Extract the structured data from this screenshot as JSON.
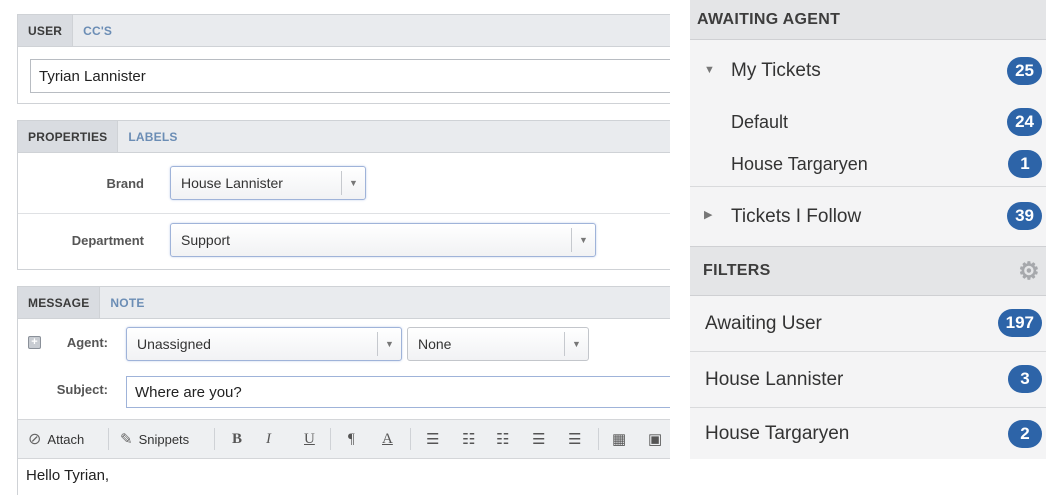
{
  "form": {
    "user_tabs": [
      "USER",
      "CC'S"
    ],
    "user_value": "Tyrian Lannister",
    "property_tabs": [
      "PROPERTIES",
      "LABELS"
    ],
    "brand_label": "Brand",
    "brand_value": "House Lannister",
    "department_label": "Department",
    "department_value": "Support",
    "message_tabs": [
      "MESSAGE",
      "NOTE"
    ],
    "agent_label": "Agent:",
    "agent_value": "Unassigned",
    "team_value": "None",
    "subject_label": "Subject:",
    "subject_value": "Where are you?",
    "toolbar": {
      "attach_label": "Attach",
      "snippets_label": "Snippets",
      "bold": "B",
      "italic": "I",
      "underline": "U",
      "paragraph": "¶",
      "font_color": "A"
    },
    "body_text": "Hello Tyrian,"
  },
  "sidebar": {
    "awaiting_agent_title": "AWAITING AGENT",
    "my_tickets": {
      "label": "My Tickets",
      "count": "25"
    },
    "sub_items": [
      {
        "label": "Default",
        "count": "24"
      },
      {
        "label": "House Targaryen",
        "count": "1"
      }
    ],
    "tickets_follow": {
      "label": "Tickets I Follow",
      "count": "39"
    },
    "filters_title": "FILTERS",
    "filters": [
      {
        "label": "Awaiting User",
        "count": "197"
      },
      {
        "label": "House Lannister",
        "count": "3"
      },
      {
        "label": "House Targaryen",
        "count": "2"
      }
    ]
  },
  "colors": {
    "badge": "#2d64a8",
    "link_tab": "#6b8db5"
  },
  "icons": [
    "paperclip-icon",
    "snippets-icon",
    "triangle-down-icon",
    "triangle-right-icon",
    "gear-icon",
    "plus-box-icon"
  ]
}
